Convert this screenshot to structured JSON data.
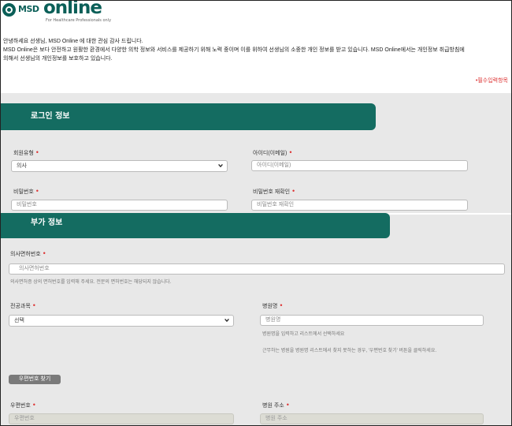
{
  "header": {
    "logo_brand": "MSD",
    "logo_online": "online",
    "logo_tagline": "For Healthcare Professionals only"
  },
  "intro": {
    "line1": "안녕하세요 선생님, MSD Online 에 대한 관심 감사 드립니다.",
    "line2": "MSD Online은 보다 안전하고 원활한 환경에서 다양한 의학 정보와 서비스를 제공하기 위해 노력 중이며 이를 위하여 선생님의 소중한 개인 정보를 받고 있습니다. MSD Online에서는 개인정보 취급방침에",
    "line3": "의해서 선생님의 개인정보를 보호하고 있습니다."
  },
  "required_note": "•필수입력항목",
  "login_section": {
    "title": "로그인 정보",
    "member_type": {
      "label": "회원유형",
      "value": "의사"
    },
    "user_id": {
      "label": "아이디(이메일)",
      "placeholder": "아이디(이메일)"
    },
    "password": {
      "label": "비밀번호",
      "placeholder": "비밀번호"
    },
    "password_confirm": {
      "label": "비밀번호 재확인",
      "placeholder": "비밀번호 재확인"
    }
  },
  "extra_section": {
    "title": "부가 정보",
    "license": {
      "label": "의사면허번호",
      "placeholder": "의사면허번호",
      "help": "의사면허증 상의 면허번호를 입력해 주세요. 전문의 면허번호는 해당되지 않습니다."
    },
    "specialty": {
      "label": "전공과목",
      "value": "선택"
    },
    "hospital": {
      "label": "병원명",
      "placeholder": "병원명",
      "help1": "병원명을 입력하고 리스트에서 선택하세요",
      "help2": "근무하는 병원을 병원명 리스트에서 찾지 못하는 경우, '우편번호 찾기' 버튼을 클릭하세요."
    },
    "zip_search_button": "우편번호 찾기",
    "zipcode": {
      "label": "우편번호",
      "placeholder": "우편번호"
    },
    "address": {
      "label": "병원 주소",
      "placeholder": "병원 주소"
    }
  },
  "required_marker": "•",
  "colors": {
    "brand_green": "#146c61",
    "required_red": "#dd3333",
    "section_gray": "#e8e8e8"
  }
}
